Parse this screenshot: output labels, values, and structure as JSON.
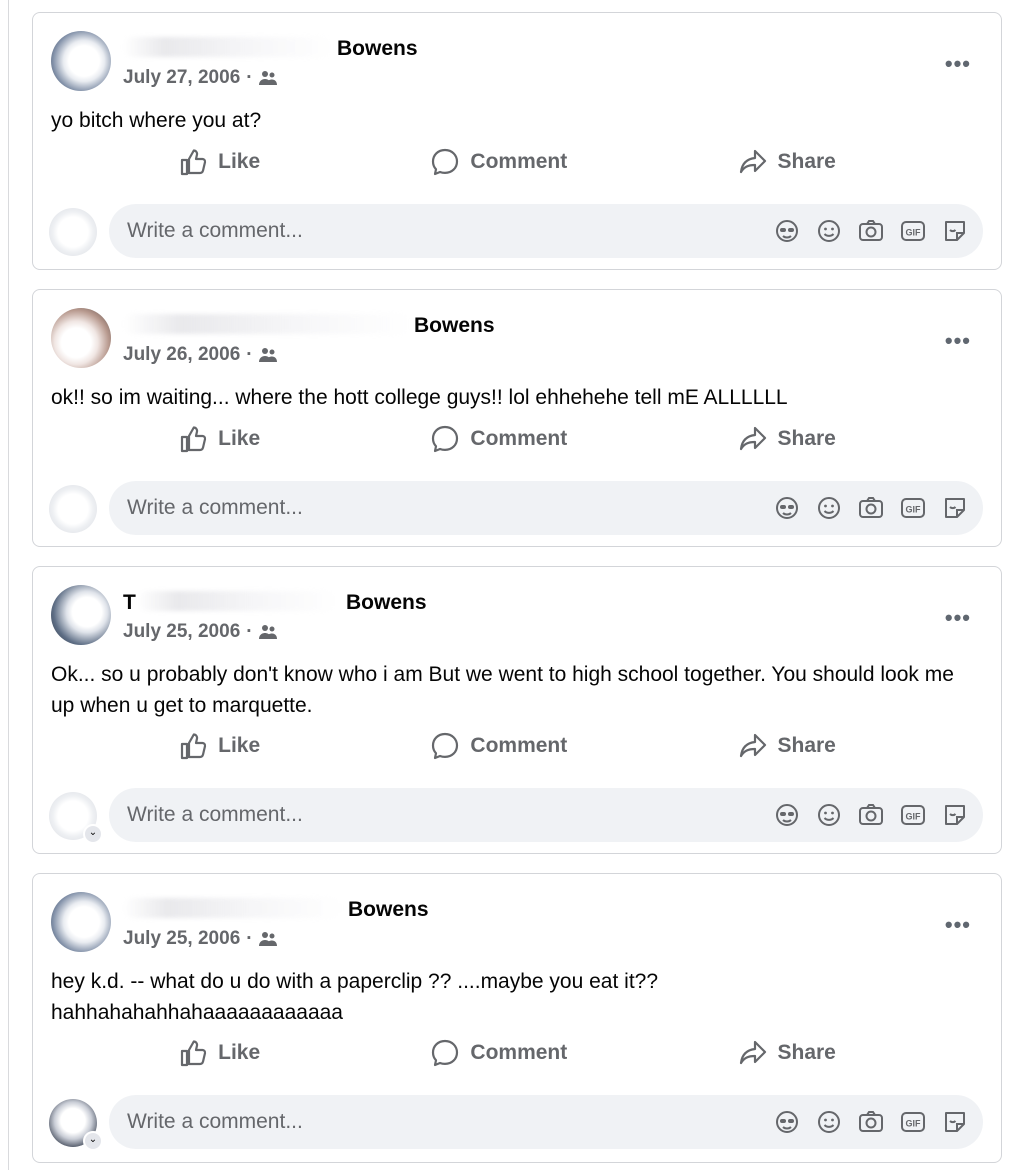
{
  "posts": [
    {
      "name": "Bowens",
      "date": "July 27, 2006",
      "separator": "·",
      "text": "yo bitch where you at?",
      "actions": {
        "like": "Like",
        "comment": "Comment",
        "share": "Share"
      },
      "comment_placeholder": "Write a comment...",
      "icons": {
        "audience": "friends-icon",
        "more": "more-options-icon"
      }
    },
    {
      "name": "Bowens",
      "date": "July 26, 2006",
      "separator": "·",
      "text": "ok!! so im waiting... where the hott college guys!! lol ehhehehe tell mE ALLLLLL",
      "actions": {
        "like": "Like",
        "comment": "Comment",
        "share": "Share"
      },
      "comment_placeholder": "Write a comment...",
      "icons": {
        "audience": "friends-icon",
        "more": "more-options-icon"
      }
    },
    {
      "name": "Bowens",
      "name_prefix": "T",
      "date": "July 25, 2006",
      "separator": "·",
      "text": "Ok... so u probably don't know who i am But we went to high school together. You should look me up when u get to marquette.",
      "actions": {
        "like": "Like",
        "comment": "Comment",
        "share": "Share"
      },
      "comment_placeholder": "Write a comment...",
      "icons": {
        "audience": "friends-icon",
        "more": "more-options-icon"
      }
    },
    {
      "name": "Bowens",
      "date": "July 25, 2006",
      "separator": "·",
      "text": "hey k.d. -- what do u do with a paperclip ?? ....maybe you eat it?? hahhahahahhahaaaaaaaaaaaa",
      "actions": {
        "like": "Like",
        "comment": "Comment",
        "share": "Share"
      },
      "comment_placeholder": "Write a comment...",
      "icons": {
        "audience": "friends-icon",
        "more": "more-options-icon"
      }
    }
  ],
  "more_glyph": "•••",
  "avatar_menu_glyph": "⌄",
  "comment_tools": [
    "avatar-sticker-icon",
    "emoji-icon",
    "camera-icon",
    "gif-icon",
    "sticker-icon"
  ],
  "colors": {
    "muted": "#65676b",
    "input_bg": "#f0f2f5",
    "border": "#d3d5d9"
  }
}
